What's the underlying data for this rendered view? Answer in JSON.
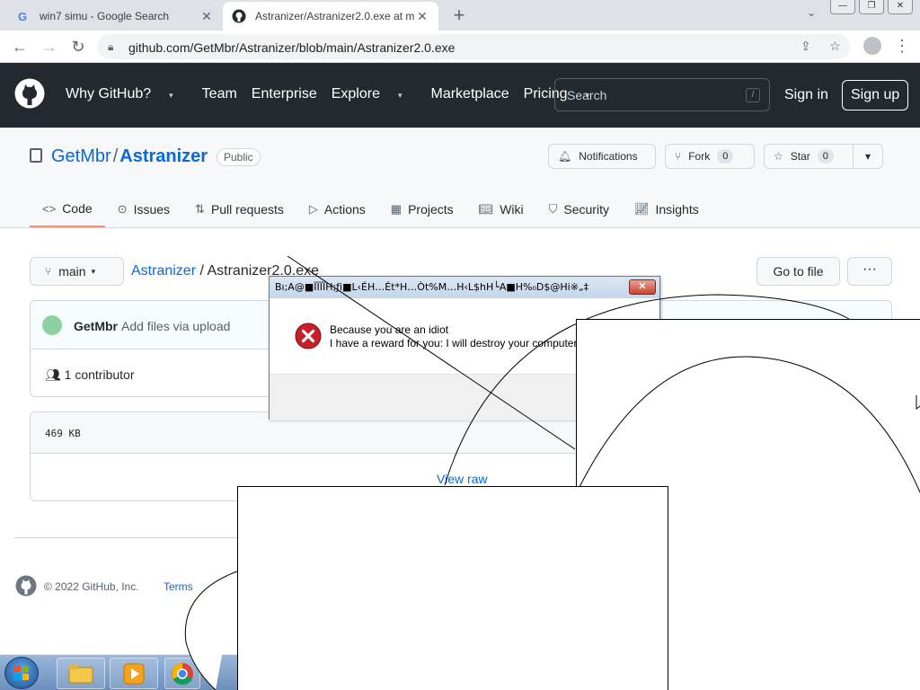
{
  "browser": {
    "tabs": [
      {
        "title": "win7 simu - Google Search",
        "favicon": "google-icon"
      },
      {
        "title": "Astranizer/Astranizer2.0.exe at m",
        "favicon": "github-icon"
      }
    ],
    "url": "github.com/GetMbr/Astranizer/blob/main/Astranizer2.0.exe",
    "new_tab": "+",
    "close_glyph": "✕"
  },
  "github": {
    "nav": [
      "Why GitHub?",
      "Team",
      "Enterprise",
      "Explore",
      "Marketplace",
      "Pricing"
    ],
    "search_placeholder": "Search",
    "search_key": "/",
    "sign_in": "Sign in",
    "sign_up": "Sign up"
  },
  "repo": {
    "owner": "GetMbr",
    "separator": "/",
    "name": "Astranizer",
    "visibility": "Public",
    "notifications": "Notifications",
    "fork_label": "Fork",
    "fork_count": "0",
    "star_label": "Star",
    "star_count": "0",
    "tabs": [
      "Code",
      "Issues",
      "Pull requests",
      "Actions",
      "Projects",
      "Wiki",
      "Security",
      "Insights"
    ]
  },
  "file": {
    "branch": "main",
    "path_repo": "Astranizer",
    "path_sep": " / ",
    "path_file": "Astranizer2.0.exe",
    "go_to_file": "Go to file",
    "more": "···",
    "commit_author": "GetMbr",
    "commit_message": "Add files via upload",
    "contributors": "1 contributor",
    "size": "469 KB",
    "view_raw": "View raw"
  },
  "footer": {
    "copyright": "© 2022 GitHub, Inc.",
    "terms": "Terms"
  },
  "dialog": {
    "title": "Bı;A@■ÏÏÏÏH;ƒi■L‹ÉH…Ét*H…Òt%M…H‹L$hH└A■H%₀D$@Hi※„‡",
    "message_line1": "Because you are an idiot",
    "message_line2": "I have a reward for you: I will destroy your computer",
    "close": "✕"
  },
  "colors": {
    "github_header": "#24292f",
    "link": "#0969da",
    "tab_underline": "#fd8c73",
    "error_red": "#c8202a"
  }
}
